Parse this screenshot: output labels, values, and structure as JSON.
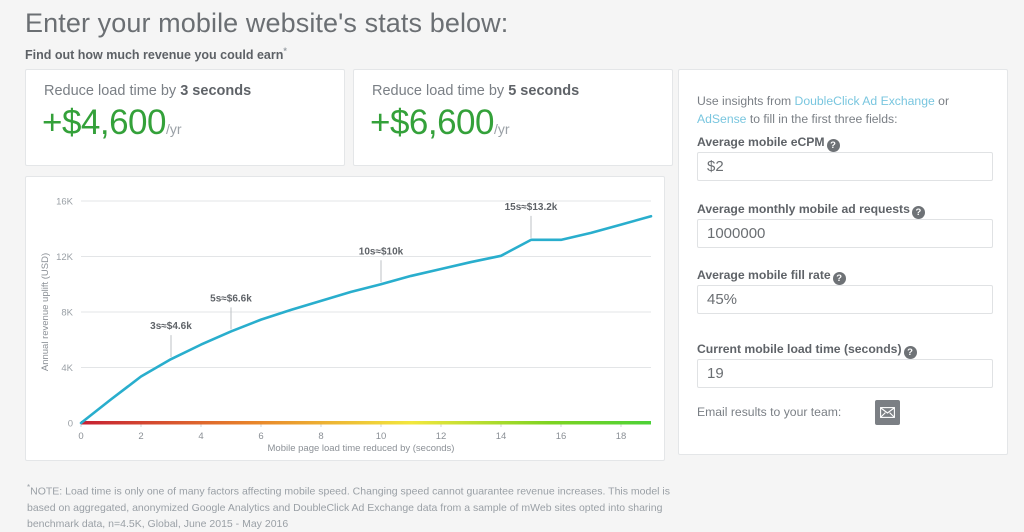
{
  "header": {
    "title": "Enter your mobile website's stats below:",
    "subtitle": "Find out how much revenue you could earn",
    "subtitle_asterisk": "*"
  },
  "cards": [
    {
      "label_prefix": "Reduce load time by ",
      "label_strong": "3 seconds",
      "value": "+$4,600",
      "suffix": "/yr"
    },
    {
      "label_prefix": "Reduce load time by ",
      "label_strong": "5 seconds",
      "value": "+$6,600",
      "suffix": "/yr"
    }
  ],
  "form": {
    "intro_prefix": "Use insights from ",
    "intro_link1": "DoubleClick Ad Exchange",
    "intro_mid": " or ",
    "intro_link2": "AdSense",
    "intro_suffix": " to fill in the first three fields:",
    "help_glyph": "?",
    "fields": [
      {
        "label": "Average mobile eCPM",
        "value": "$2"
      },
      {
        "label": "Average monthly mobile ad requests",
        "value": "1000000"
      },
      {
        "label": "Average mobile fill rate",
        "value": "45%"
      },
      {
        "label": "Current mobile load time (seconds)",
        "value": "19"
      }
    ],
    "email_label": "Email results to your team:",
    "email_icon": "envelope-icon"
  },
  "footnote": {
    "asterisk": "*",
    "text": "NOTE: Load time is only one of many factors affecting mobile speed. Changing speed cannot guarantee revenue increases. This model is based on aggregated, anonymized Google Analytics and DoubleClick Ad Exchange data from a sample of mWeb sites opted into sharing benchmark data, n=4.5K, Global, June 2015 - May 2016"
  },
  "colors": {
    "line": "#29aecd",
    "value_green": "#34a13a",
    "link": "#79c6df",
    "grid": "#e3e5e7",
    "gradient_start": "#c62033",
    "gradient_mid1": "#e8842a",
    "gradient_mid2": "#f2e73d",
    "gradient_end": "#4cd137"
  },
  "chart_data": {
    "type": "line",
    "title": "",
    "xlabel": "Mobile page load time reduced by (seconds)",
    "ylabel": "Annual revenue uplift (USD)",
    "xlim": [
      0,
      19
    ],
    "ylim": [
      0,
      16000
    ],
    "xticks": [
      0,
      2,
      4,
      6,
      8,
      10,
      12,
      14,
      16,
      18
    ],
    "xtick_labels": [
      "0",
      "2",
      "4",
      "6",
      "8",
      "10",
      "12",
      "14",
      "16",
      "18"
    ],
    "yticks": [
      0,
      4000,
      8000,
      12000,
      16000
    ],
    "ytick_labels": [
      "0",
      "4K",
      "8K",
      "12K",
      "16K"
    ],
    "grid": true,
    "legend": "none",
    "series": [
      {
        "name": "Annual revenue uplift",
        "color": "#29aecd",
        "x": [
          0,
          1,
          2,
          3,
          4,
          5,
          6,
          7,
          8,
          9,
          10,
          11,
          12,
          13,
          14,
          15,
          16,
          17,
          18,
          19
        ],
        "y": [
          0,
          1700,
          3350,
          4600,
          5650,
          6600,
          7450,
          8150,
          8800,
          9450,
          10000,
          10600,
          11100,
          11600,
          12050,
          13200,
          13200,
          13700,
          14300,
          14900
        ]
      }
    ],
    "annotations": [
      {
        "label": "3s≈$4.6k",
        "x": 3,
        "y": 4600
      },
      {
        "label": "5s≈$6.6k",
        "x": 5,
        "y": 6600
      },
      {
        "label": "10s≈$10k",
        "x": 10,
        "y": 10000
      },
      {
        "label": "15s≈$13.2k",
        "x": 15,
        "y": 13200
      }
    ],
    "gradient_bar": {
      "description": "red-to-green speed gradient along x-axis baseline",
      "stops": [
        "#c62033",
        "#e8842a",
        "#f2e73d",
        "#4cd137"
      ]
    }
  }
}
